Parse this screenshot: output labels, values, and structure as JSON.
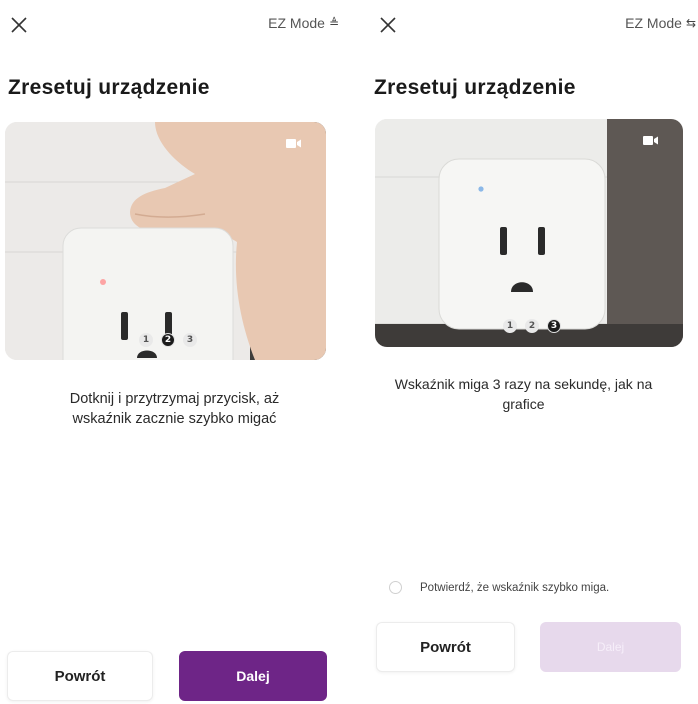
{
  "left_screen": {
    "mode_label": "EZ Mode",
    "title": "Zresetuj urządzenie",
    "steps": [
      "1",
      "2",
      "3"
    ],
    "description_line1": "Dotknij i przytrzymaj przycisk, aż",
    "description_line2": "wskaźnik zacznie szybko migać",
    "back_label": "Powrót",
    "next_label": "Dalej"
  },
  "right_screen": {
    "mode_label": "EZ Mode",
    "title": "Zresetuj urządzenie",
    "steps": [
      "1",
      "2",
      "3"
    ],
    "description_line1": "Wskaźnik miga 3 razy na sekundę, jak na",
    "description_line2": "grafice",
    "confirm_label": "Potwierdź, że wskaźnik szybko miga.",
    "back_label": "Powrót",
    "next_label": "Dalej"
  },
  "colors": {
    "accent": "#6e2587",
    "accent_disabled": "#e7d9ec"
  },
  "icons": {
    "close": "close-icon",
    "mode": "swap-icon",
    "camera": "video-camera-icon"
  }
}
